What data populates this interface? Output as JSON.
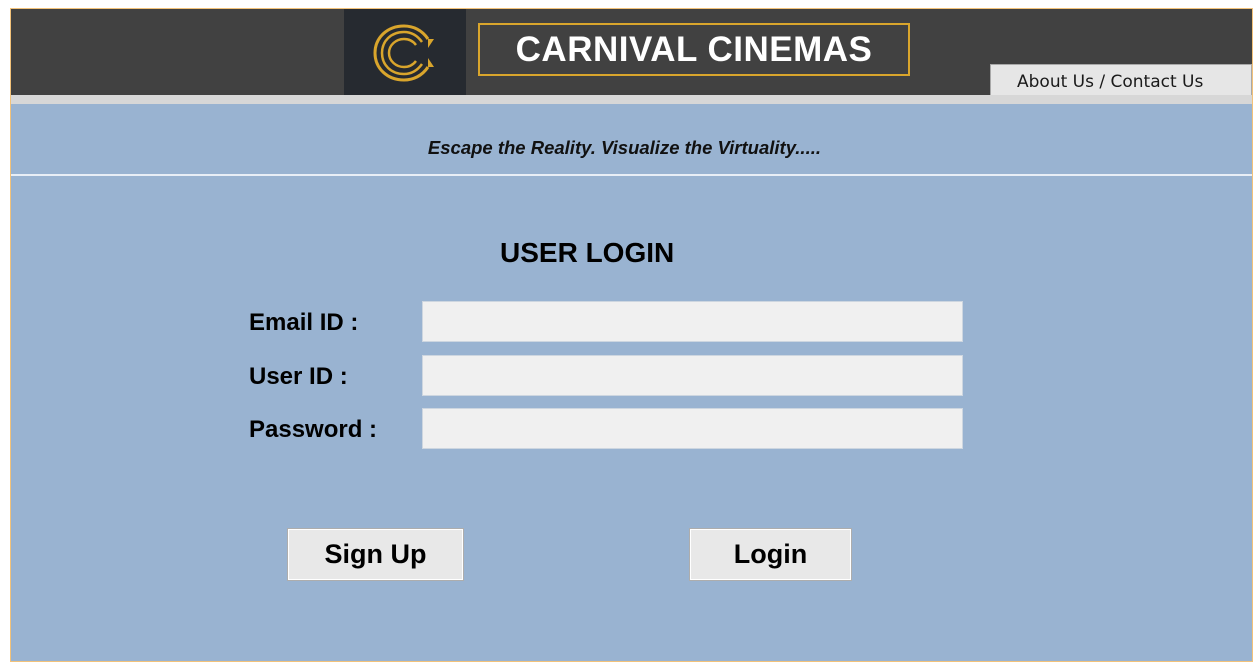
{
  "header": {
    "brand_title": "CARNIVAL CINEMAS",
    "about_link": "About Us / Contact Us",
    "logo_icon": "carnival-c-logo",
    "colors": {
      "header_bg": "#414141",
      "logo_bg": "#262a30",
      "gold": "#d9a52c",
      "page_bg": "#99b3d1"
    }
  },
  "tagline": "Escape the Reality. Visualize the Virtuality.....",
  "login": {
    "title": "USER LOGIN",
    "fields": [
      {
        "label": "Email ID :",
        "value": "",
        "placeholder": ""
      },
      {
        "label": "User ID :",
        "value": "",
        "placeholder": ""
      },
      {
        "label": "Password :",
        "value": "",
        "placeholder": ""
      }
    ],
    "signup_label": "Sign Up",
    "login_label": "Login"
  }
}
